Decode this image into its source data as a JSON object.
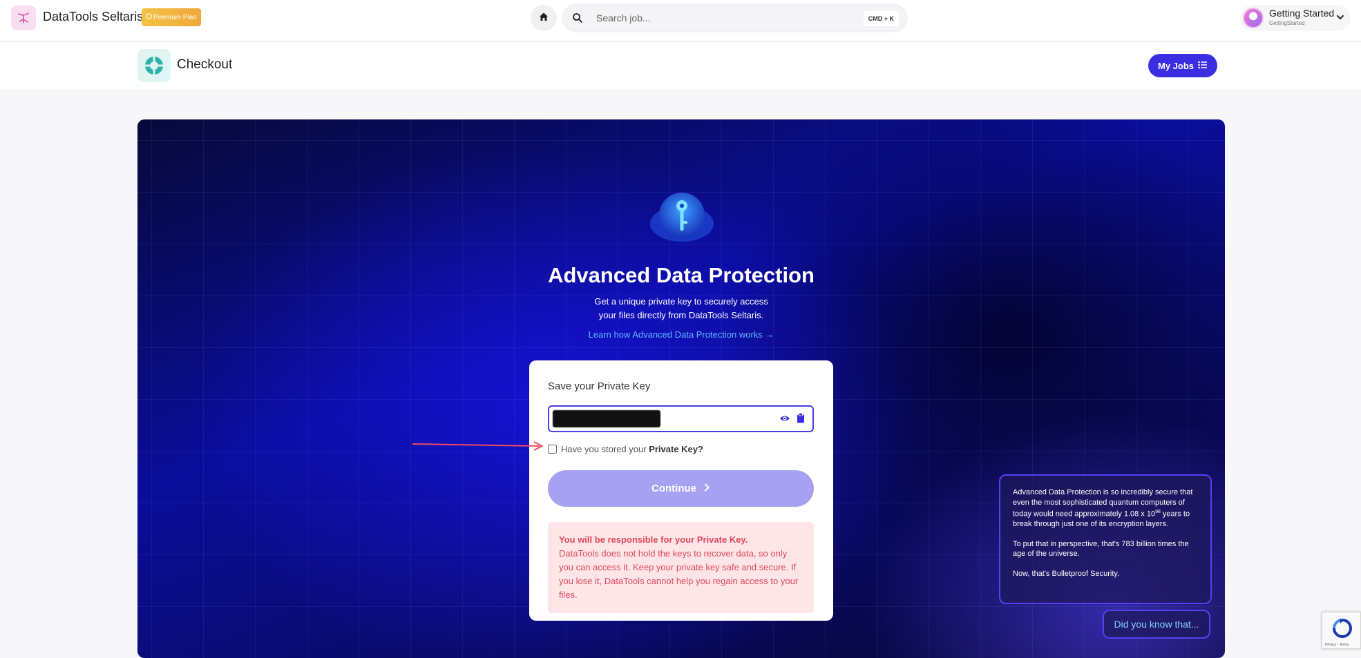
{
  "app": {
    "brand": "DataTools Seltaris",
    "plan_badge": "Premium Plan"
  },
  "search": {
    "placeholder": "Search job...",
    "shortcut": "CMD + K"
  },
  "user": {
    "name": "Getting Started",
    "sub": "GettingStarted"
  },
  "page": {
    "title": "Checkout",
    "my_jobs_label": "My Jobs"
  },
  "hero": {
    "title": "Advanced Data Protection",
    "desc_line1": "Get a unique private key to securely access",
    "desc_line2": "your files directly from DataTools Seltaris.",
    "learn_link": "Learn how Advanced Data Protection works →"
  },
  "card": {
    "label": "Save your Private Key",
    "checkbox_prefix": "Have you stored your ",
    "checkbox_bold": "Private Key?",
    "continue_label": "Continue",
    "warning_title": "You will be responsible for your Private Key.",
    "warning_body": "DataTools does not hold the keys to recover data, so only you can access it. Keep your private key safe and secure. If you lose it, DataTools cannot help you regain access to your files."
  },
  "info": {
    "p1_a": "Advanced Data Protection is so incredibly secure that even the most sophisticated quantum computers of today would need approximately 1.08 x 10",
    "p1_sup": "98",
    "p1_b": " years to break through just one of its encryption layers.",
    "p2": "To put that in perspective, that's 783 billion times the age of the universe.",
    "p3": "Now, that's Bulletproof Security.",
    "did_you_know": "Did you know that..."
  },
  "recaptcha": {
    "text": "Privacy - Terms"
  },
  "colors": {
    "accent": "#3b2ee0",
    "continue_disabled": "#a7a1f1",
    "warning_text": "#e0485b",
    "warning_bg": "#fde5e8",
    "link": "#5fb8ff",
    "annotation_arrow": "#ee4b5f"
  },
  "icons": [
    "logo-icon",
    "crown-icon",
    "home-icon",
    "search-icon",
    "chevron-down-icon",
    "checkout-logo-icon",
    "list-icon",
    "shield-key-icon",
    "eye-icon",
    "clipboard-icon",
    "chevron-right-icon",
    "annotation-arrow",
    "recaptcha-icon"
  ]
}
